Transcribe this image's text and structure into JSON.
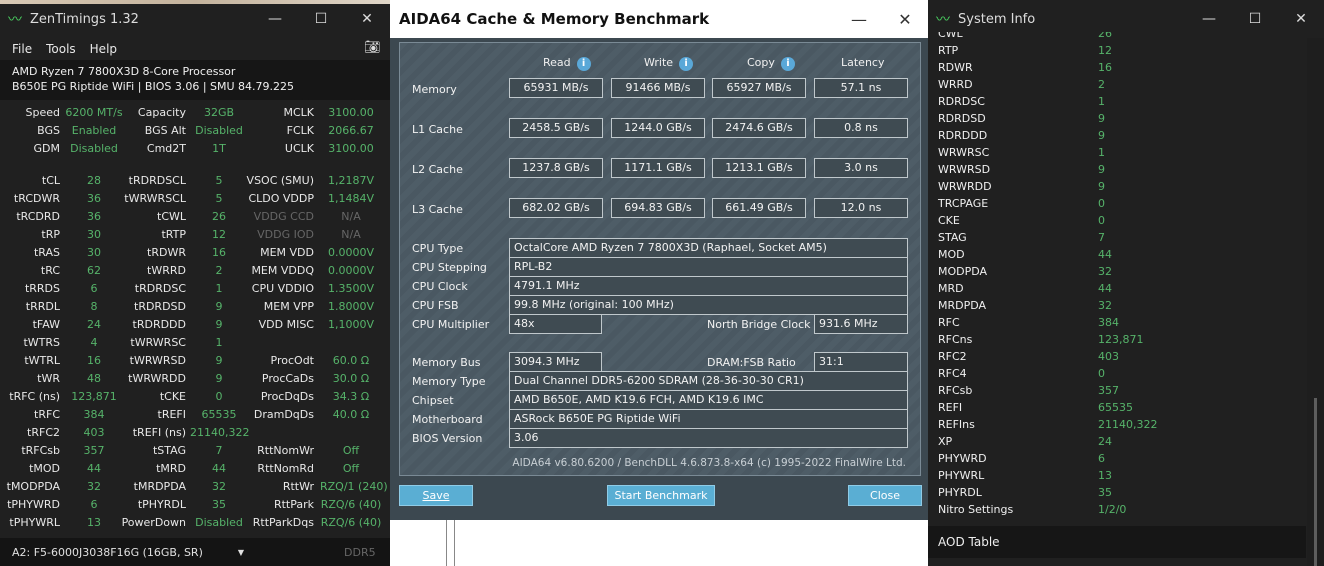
{
  "zen": {
    "title": "ZenTimings 1.32",
    "menu": [
      "File",
      "Tools",
      "Help"
    ],
    "cpu": "AMD Ryzen 7 7800X3D 8-Core Processor",
    "board": "B650E PG Riptide WiFi | BIOS 3.06 | SMU 84.79.225",
    "top_rows": [
      {
        "l1": "Speed",
        "v1": "6200 MT/s",
        "l2": "Capacity",
        "v2": "32GB",
        "l3": "MCLK",
        "v3": "3100.00"
      },
      {
        "l1": "BGS",
        "v1": "Enabled",
        "l2": "BGS Alt",
        "v2": "Disabled",
        "l3": "FCLK",
        "v3": "2066.67"
      },
      {
        "l1": "GDM",
        "v1": "Disabled",
        "l2": "Cmd2T",
        "v2": "1T",
        "l3": "UCLK",
        "v3": "3100.00"
      }
    ],
    "rows": [
      {
        "l1": "tCL",
        "v1": "28",
        "l2": "tRDRDSCL",
        "v2": "5",
        "l3": "VSOC (SMU)",
        "v3": "1,2187V"
      },
      {
        "l1": "tRCDWR",
        "v1": "36",
        "l2": "tWRWRSCL",
        "v2": "5",
        "l3": "CLDO VDDP",
        "v3": "1,1484V"
      },
      {
        "l1": "tRCDRD",
        "v1": "36",
        "l2": "tCWL",
        "v2": "26",
        "l3": "VDDG CCD",
        "v3": "N/A"
      },
      {
        "l1": "tRP",
        "v1": "30",
        "l2": "tRTP",
        "v2": "12",
        "l3": "VDDG IOD",
        "v3": "N/A"
      },
      {
        "l1": "tRAS",
        "v1": "30",
        "l2": "tRDWR",
        "v2": "16",
        "l3": "MEM VDD",
        "v3": "0.0000V"
      },
      {
        "l1": "tRC",
        "v1": "62",
        "l2": "tWRRD",
        "v2": "2",
        "l3": "MEM VDDQ",
        "v3": "0.0000V"
      },
      {
        "l1": "tRRDS",
        "v1": "6",
        "l2": "tRDRDSC",
        "v2": "1",
        "l3": "CPU VDDIO",
        "v3": "1.3500V"
      },
      {
        "l1": "tRRDL",
        "v1": "8",
        "l2": "tRDRDSD",
        "v2": "9",
        "l3": "MEM VPP",
        "v3": "1.8000V"
      },
      {
        "l1": "tFAW",
        "v1": "24",
        "l2": "tRDRDDD",
        "v2": "9",
        "l3": "VDD MISC",
        "v3": "1,1000V"
      },
      {
        "l1": "tWTRS",
        "v1": "4",
        "l2": "tWRWRSC",
        "v2": "1",
        "l3": "",
        "v3": ""
      },
      {
        "l1": "tWTRL",
        "v1": "16",
        "l2": "tWRWRSD",
        "v2": "9",
        "l3": "ProcOdt",
        "v3": "60.0 Ω"
      },
      {
        "l1": "tWR",
        "v1": "48",
        "l2": "tWRWRDD",
        "v2": "9",
        "l3": "ProcCaDs",
        "v3": "30.0 Ω"
      },
      {
        "l1": "tRFC (ns)",
        "v1": "123,871",
        "l2": "tCKE",
        "v2": "0",
        "l3": "ProcDqDs",
        "v3": "34.3 Ω"
      },
      {
        "l1": "tRFC",
        "v1": "384",
        "l2": "tREFI",
        "v2": "65535",
        "l3": "DramDqDs",
        "v3": "40.0 Ω"
      },
      {
        "l1": "tRFC2",
        "v1": "403",
        "l2": "tREFI (ns)",
        "v2": "21140,322",
        "l3": "",
        "v3": ""
      },
      {
        "l1": "tRFCsb",
        "v1": "357",
        "l2": "tSTAG",
        "v2": "7",
        "l3": "RttNomWr",
        "v3": "Off"
      },
      {
        "l1": "tMOD",
        "v1": "44",
        "l2": "tMRD",
        "v2": "44",
        "l3": "RttNomRd",
        "v3": "Off"
      },
      {
        "l1": "tMODPDA",
        "v1": "32",
        "l2": "tMRDPDA",
        "v2": "32",
        "l3": "RttWr",
        "v3": "RZQ/1 (240)"
      },
      {
        "l1": "tPHYWRD",
        "v1": "6",
        "l2": "tPHYRDL",
        "v2": "35",
        "l3": "RttPark",
        "v3": "RZQ/6 (40)"
      },
      {
        "l1": "tPHYWRL",
        "v1": "13",
        "l2": "PowerDown",
        "v2": "Disabled",
        "l3": "RttParkDqs",
        "v3": "RZQ/6 (40)"
      }
    ],
    "module": "A2: F5-6000J3038F16G (16GB, SR)",
    "ddr": "DDR5"
  },
  "aida": {
    "title": "AIDA64 Cache & Memory Benchmark",
    "headers": {
      "read": "Read",
      "write": "Write",
      "copy": "Copy",
      "latency": "Latency"
    },
    "bench": [
      {
        "label": "Memory",
        "read": "65931 MB/s",
        "write": "91466 MB/s",
        "copy": "65927 MB/s",
        "latency": "57.1 ns"
      },
      {
        "label": "L1 Cache",
        "read": "2458.5 GB/s",
        "write": "1244.0 GB/s",
        "copy": "2474.6 GB/s",
        "latency": "0.8 ns"
      },
      {
        "label": "L2 Cache",
        "read": "1237.8 GB/s",
        "write": "1171.1 GB/s",
        "copy": "1213.1 GB/s",
        "latency": "3.0 ns"
      },
      {
        "label": "L3 Cache",
        "read": "682.02 GB/s",
        "write": "694.83 GB/s",
        "copy": "661.49 GB/s",
        "latency": "12.0 ns"
      }
    ],
    "cpu_type_label": "CPU Type",
    "cpu_type": "OctalCore AMD Ryzen 7 7800X3D  (Raphael, Socket AM5)",
    "cpu_stepping_label": "CPU Stepping",
    "cpu_stepping": "RPL-B2",
    "cpu_clock_label": "CPU Clock",
    "cpu_clock": "4791.1 MHz",
    "cpu_fsb_label": "CPU FSB",
    "cpu_fsb": "99.8 MHz  (original: 100 MHz)",
    "cpu_mult_label": "CPU Multiplier",
    "cpu_mult": "48x",
    "nb_clock_label": "North Bridge Clock",
    "nb_clock": "931.6 MHz",
    "mem_bus_label": "Memory Bus",
    "mem_bus": "3094.3 MHz",
    "dram_ratio_label": "DRAM:FSB Ratio",
    "dram_ratio": "31:1",
    "mem_type_label": "Memory Type",
    "mem_type": "Dual Channel DDR5-6200 SDRAM  (28-36-30-30 CR1)",
    "chipset_label": "Chipset",
    "chipset": "AMD B650E, AMD K19.6 FCH, AMD K19.6 IMC",
    "mobo_label": "Motherboard",
    "mobo": "ASRock B650E PG Riptide WiFi",
    "bios_label": "BIOS Version",
    "bios": "3.06",
    "copyright": "AIDA64 v6.80.6200 / BenchDLL 4.6.873.8-x64  (c) 1995-2022 FinalWire Ltd.",
    "buttons": {
      "save": "Save",
      "start": "Start Benchmark",
      "close": "Close"
    }
  },
  "sys": {
    "title": "System Info",
    "items": [
      {
        "k": "CWL",
        "v": "26"
      },
      {
        "k": "RTP",
        "v": "12"
      },
      {
        "k": "RDWR",
        "v": "16"
      },
      {
        "k": "WRRD",
        "v": "2"
      },
      {
        "k": "RDRDSC",
        "v": "1"
      },
      {
        "k": "RDRDSD",
        "v": "9"
      },
      {
        "k": "RDRDDD",
        "v": "9"
      },
      {
        "k": "WRWRSC",
        "v": "1"
      },
      {
        "k": "WRWRSD",
        "v": "9"
      },
      {
        "k": "WRWRDD",
        "v": "9"
      },
      {
        "k": "TRCPAGE",
        "v": "0"
      },
      {
        "k": "CKE",
        "v": "0"
      },
      {
        "k": "STAG",
        "v": "7"
      },
      {
        "k": "MOD",
        "v": "44"
      },
      {
        "k": "MODPDA",
        "v": "32"
      },
      {
        "k": "MRD",
        "v": "44"
      },
      {
        "k": "MRDPDA",
        "v": "32"
      },
      {
        "k": "RFC",
        "v": "384"
      },
      {
        "k": "RFCns",
        "v": "123,871"
      },
      {
        "k": "RFC2",
        "v": "403"
      },
      {
        "k": "RFC4",
        "v": "0"
      },
      {
        "k": "RFCsb",
        "v": "357"
      },
      {
        "k": "REFI",
        "v": "65535"
      },
      {
        "k": "REFIns",
        "v": "21140,322"
      },
      {
        "k": "XP",
        "v": "24"
      },
      {
        "k": "PHYWRD",
        "v": "6"
      },
      {
        "k": "PHYWRL",
        "v": "13"
      },
      {
        "k": "PHYRDL",
        "v": "35"
      },
      {
        "k": "Nitro Settings",
        "v": "1/2/0"
      }
    ],
    "aod": "AOD Table"
  }
}
